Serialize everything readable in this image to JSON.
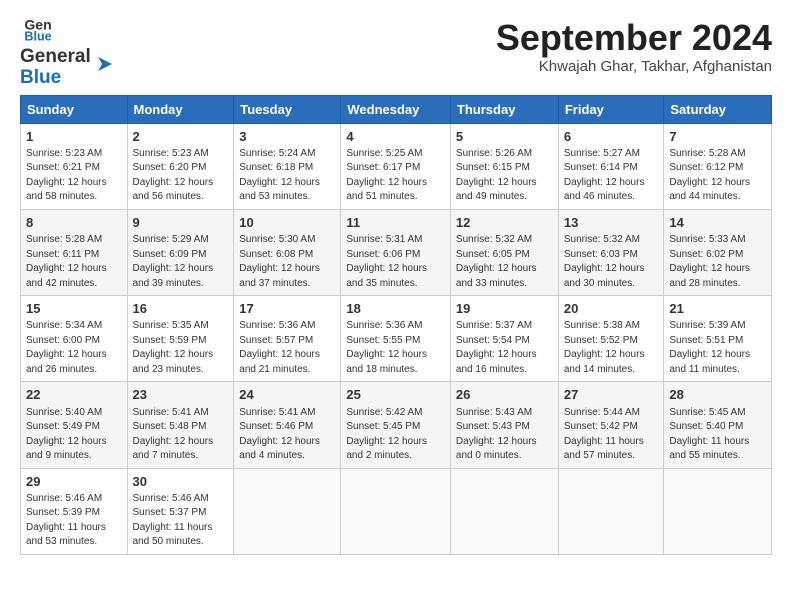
{
  "header": {
    "logo_line1": "General",
    "logo_line2": "Blue",
    "month_title": "September 2024",
    "subtitle": "Khwajah Ghar, Takhar, Afghanistan"
  },
  "weekdays": [
    "Sunday",
    "Monday",
    "Tuesday",
    "Wednesday",
    "Thursday",
    "Friday",
    "Saturday"
  ],
  "weeks": [
    [
      {
        "day": "1",
        "info": "Sunrise: 5:23 AM\nSunset: 6:21 PM\nDaylight: 12 hours\nand 58 minutes."
      },
      {
        "day": "2",
        "info": "Sunrise: 5:23 AM\nSunset: 6:20 PM\nDaylight: 12 hours\nand 56 minutes."
      },
      {
        "day": "3",
        "info": "Sunrise: 5:24 AM\nSunset: 6:18 PM\nDaylight: 12 hours\nand 53 minutes."
      },
      {
        "day": "4",
        "info": "Sunrise: 5:25 AM\nSunset: 6:17 PM\nDaylight: 12 hours\nand 51 minutes."
      },
      {
        "day": "5",
        "info": "Sunrise: 5:26 AM\nSunset: 6:15 PM\nDaylight: 12 hours\nand 49 minutes."
      },
      {
        "day": "6",
        "info": "Sunrise: 5:27 AM\nSunset: 6:14 PM\nDaylight: 12 hours\nand 46 minutes."
      },
      {
        "day": "7",
        "info": "Sunrise: 5:28 AM\nSunset: 6:12 PM\nDaylight: 12 hours\nand 44 minutes."
      }
    ],
    [
      {
        "day": "8",
        "info": "Sunrise: 5:28 AM\nSunset: 6:11 PM\nDaylight: 12 hours\nand 42 minutes."
      },
      {
        "day": "9",
        "info": "Sunrise: 5:29 AM\nSunset: 6:09 PM\nDaylight: 12 hours\nand 39 minutes."
      },
      {
        "day": "10",
        "info": "Sunrise: 5:30 AM\nSunset: 6:08 PM\nDaylight: 12 hours\nand 37 minutes."
      },
      {
        "day": "11",
        "info": "Sunrise: 5:31 AM\nSunset: 6:06 PM\nDaylight: 12 hours\nand 35 minutes."
      },
      {
        "day": "12",
        "info": "Sunrise: 5:32 AM\nSunset: 6:05 PM\nDaylight: 12 hours\nand 33 minutes."
      },
      {
        "day": "13",
        "info": "Sunrise: 5:32 AM\nSunset: 6:03 PM\nDaylight: 12 hours\nand 30 minutes."
      },
      {
        "day": "14",
        "info": "Sunrise: 5:33 AM\nSunset: 6:02 PM\nDaylight: 12 hours\nand 28 minutes."
      }
    ],
    [
      {
        "day": "15",
        "info": "Sunrise: 5:34 AM\nSunset: 6:00 PM\nDaylight: 12 hours\nand 26 minutes."
      },
      {
        "day": "16",
        "info": "Sunrise: 5:35 AM\nSunset: 5:59 PM\nDaylight: 12 hours\nand 23 minutes."
      },
      {
        "day": "17",
        "info": "Sunrise: 5:36 AM\nSunset: 5:57 PM\nDaylight: 12 hours\nand 21 minutes."
      },
      {
        "day": "18",
        "info": "Sunrise: 5:36 AM\nSunset: 5:55 PM\nDaylight: 12 hours\nand 18 minutes."
      },
      {
        "day": "19",
        "info": "Sunrise: 5:37 AM\nSunset: 5:54 PM\nDaylight: 12 hours\nand 16 minutes."
      },
      {
        "day": "20",
        "info": "Sunrise: 5:38 AM\nSunset: 5:52 PM\nDaylight: 12 hours\nand 14 minutes."
      },
      {
        "day": "21",
        "info": "Sunrise: 5:39 AM\nSunset: 5:51 PM\nDaylight: 12 hours\nand 11 minutes."
      }
    ],
    [
      {
        "day": "22",
        "info": "Sunrise: 5:40 AM\nSunset: 5:49 PM\nDaylight: 12 hours\nand 9 minutes."
      },
      {
        "day": "23",
        "info": "Sunrise: 5:41 AM\nSunset: 5:48 PM\nDaylight: 12 hours\nand 7 minutes."
      },
      {
        "day": "24",
        "info": "Sunrise: 5:41 AM\nSunset: 5:46 PM\nDaylight: 12 hours\nand 4 minutes."
      },
      {
        "day": "25",
        "info": "Sunrise: 5:42 AM\nSunset: 5:45 PM\nDaylight: 12 hours\nand 2 minutes."
      },
      {
        "day": "26",
        "info": "Sunrise: 5:43 AM\nSunset: 5:43 PM\nDaylight: 12 hours\nand 0 minutes."
      },
      {
        "day": "27",
        "info": "Sunrise: 5:44 AM\nSunset: 5:42 PM\nDaylight: 11 hours\nand 57 minutes."
      },
      {
        "day": "28",
        "info": "Sunrise: 5:45 AM\nSunset: 5:40 PM\nDaylight: 11 hours\nand 55 minutes."
      }
    ],
    [
      {
        "day": "29",
        "info": "Sunrise: 5:46 AM\nSunset: 5:39 PM\nDaylight: 11 hours\nand 53 minutes."
      },
      {
        "day": "30",
        "info": "Sunrise: 5:46 AM\nSunset: 5:37 PM\nDaylight: 11 hours\nand 50 minutes."
      },
      {
        "day": "",
        "info": ""
      },
      {
        "day": "",
        "info": ""
      },
      {
        "day": "",
        "info": ""
      },
      {
        "day": "",
        "info": ""
      },
      {
        "day": "",
        "info": ""
      }
    ]
  ]
}
